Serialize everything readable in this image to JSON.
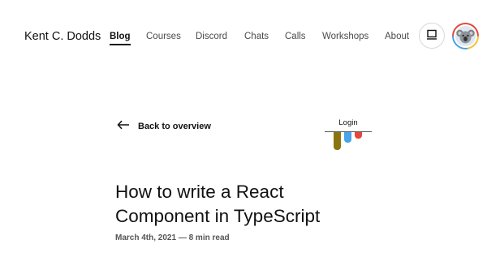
{
  "header": {
    "site_name": "Kent C. Dodds",
    "nav": [
      {
        "label": "Blog",
        "active": true
      },
      {
        "label": "Courses",
        "active": false
      },
      {
        "label": "Discord",
        "active": false
      },
      {
        "label": "Chats",
        "active": false
      },
      {
        "label": "Calls",
        "active": false
      },
      {
        "label": "Workshops",
        "active": false
      },
      {
        "label": "About",
        "active": false
      }
    ],
    "theme_toggle_icon": "laptop-icon",
    "avatar_icon": "koala-avatar"
  },
  "main": {
    "back_link": "Back to overview",
    "login_label": "Login",
    "title_line1": "How to write a React",
    "title_line2": "Component in TypeScript",
    "meta": "March 4th, 2021 — 8 min read"
  },
  "colors": {
    "bar_gold": "#8a7410",
    "bar_blue": "#4aa3e8",
    "bar_red": "#e6463c"
  }
}
